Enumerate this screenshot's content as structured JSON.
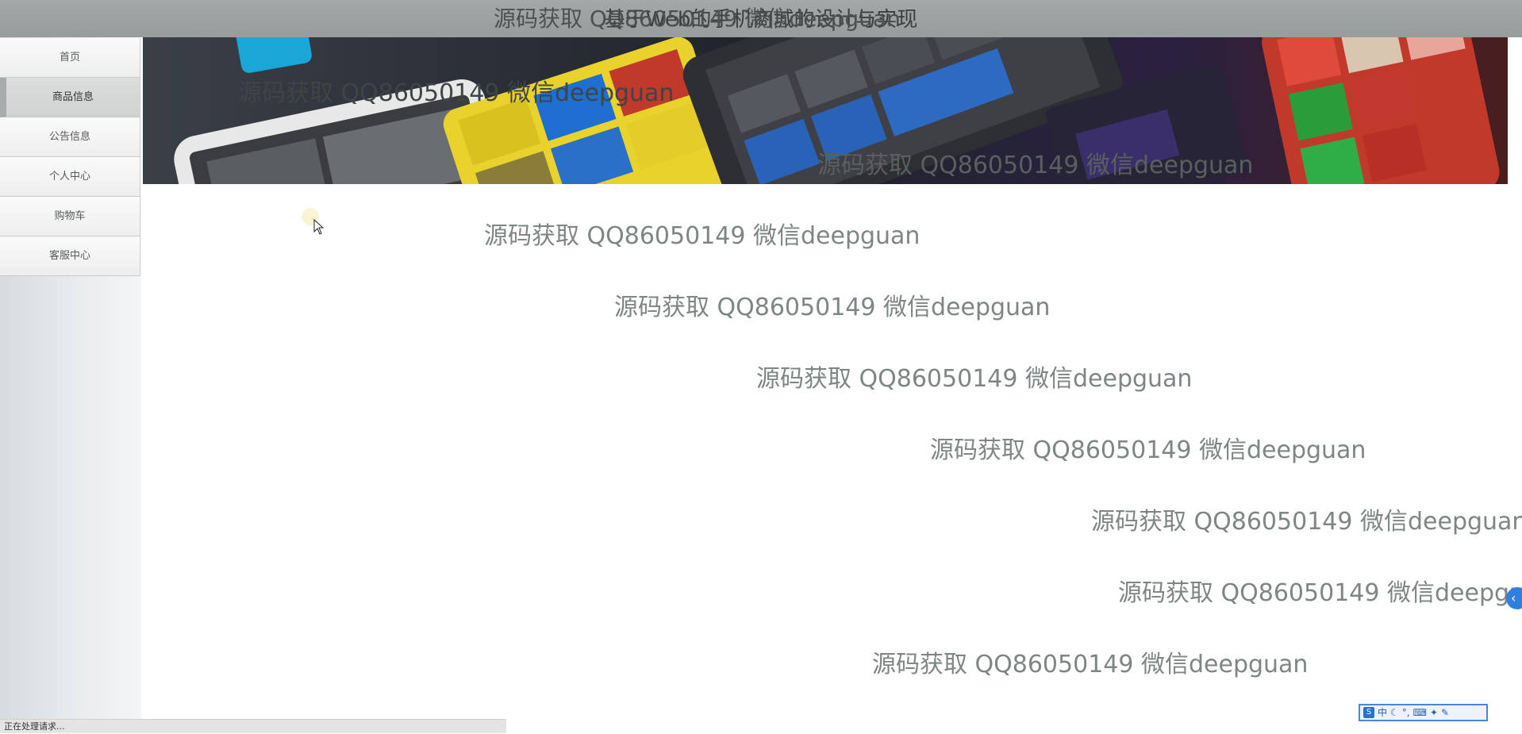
{
  "app": {
    "title": "基于Web的手机商城的设计与实现"
  },
  "sidebar": {
    "items": [
      {
        "label": "首页"
      },
      {
        "label": "商品信息"
      },
      {
        "label": "公告信息"
      },
      {
        "label": "个人中心"
      },
      {
        "label": "购物车"
      },
      {
        "label": "客服中心"
      }
    ],
    "active_index": 1
  },
  "watermarks": [
    "源码获取 QQ86050149 微信deepguan",
    "源码获取 QQ86050149 微信deepguan",
    "源码获取 QQ86050149 微信deepguan",
    "源码获取 QQ86050149 微信deepguan",
    "源码获取 QQ86050149 微信deepguan",
    "源码获取 QQ86050149 微信deepguan",
    "源码获取 QQ86050149 微信deepguan",
    "源码获取 QQ86050149 微信deepguan",
    "源码获取 QQ86050149 微信deepguan",
    "源码获取 QQ86050149 微信deepguan",
    "源码获取 QQ86050149 微信deepguan"
  ],
  "status": {
    "text": "正在处理请求..."
  },
  "ime_toolbar": {
    "mode": "中"
  },
  "colors": {
    "topbar": "#9ba1a0",
    "sidebar_active": "#d2d5d3",
    "float_button": "#2f7fe0"
  }
}
